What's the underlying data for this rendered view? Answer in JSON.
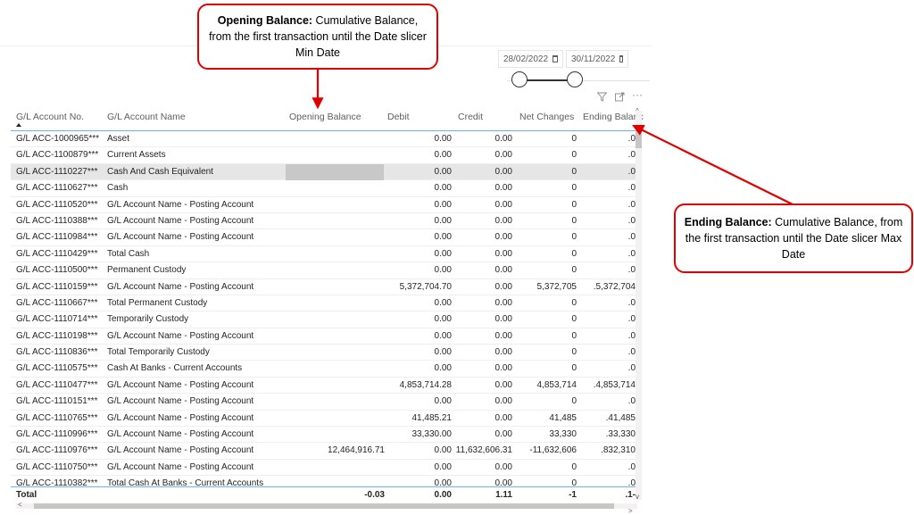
{
  "annotations": {
    "opening": {
      "title": "Opening Balance:",
      "text": " Cumulative Balance, from the first transaction until the Date slicer Min Date"
    },
    "ending": {
      "title": "Ending Balance:",
      "text": " Cumulative Balance, from the first transaction until the Date slicer Max Date"
    },
    "color": "#e00000"
  },
  "date_slicer": {
    "start_date": "28/02/2022",
    "end_date": "30/11/2022",
    "calendar_icon": "calendar-icon"
  },
  "visual_header": {
    "icons": [
      "filter-icon",
      "focus-mode-icon",
      "more-options-icon"
    ],
    "more_glyph": "···"
  },
  "table": {
    "columns": [
      "G/L Account No.",
      "G/L Account Name",
      "Opening Balance",
      "Debit",
      "Credit",
      "Net Changes",
      "Ending Balanc"
    ],
    "sorted_column": "G/L Account No.",
    "accent_color": "#6cb2eb",
    "rows": [
      {
        "no": "G/L ACC-1000965***",
        "name": "Asset",
        "opening": "",
        "debit": "0.00",
        "credit": "0.00",
        "net": "0",
        "ending": "0."
      },
      {
        "no": "G/L ACC-1100879***",
        "name": "Current Assets",
        "opening": "",
        "debit": "0.00",
        "credit": "0.00",
        "net": "0",
        "ending": "0."
      },
      {
        "no": "G/L ACC-1110227***",
        "name": "Cash And Cash Equivalent",
        "opening": "",
        "debit": "0.00",
        "credit": "0.00",
        "net": "0",
        "ending": "0.",
        "highlighted": true
      },
      {
        "no": "G/L ACC-1110627***",
        "name": "Cash",
        "opening": "",
        "debit": "0.00",
        "credit": "0.00",
        "net": "0",
        "ending": "0."
      },
      {
        "no": "G/L ACC-1110520***",
        "name": "G/L Account Name - Posting Account",
        "opening": "",
        "debit": "0.00",
        "credit": "0.00",
        "net": "0",
        "ending": "0."
      },
      {
        "no": "G/L ACC-1110388***",
        "name": "G/L Account Name - Posting Account",
        "opening": "",
        "debit": "0.00",
        "credit": "0.00",
        "net": "0",
        "ending": "0."
      },
      {
        "no": "G/L ACC-1110984***",
        "name": "G/L Account Name - Posting Account",
        "opening": "",
        "debit": "0.00",
        "credit": "0.00",
        "net": "0",
        "ending": "0."
      },
      {
        "no": "G/L ACC-1110429***",
        "name": "Total Cash",
        "opening": "",
        "debit": "0.00",
        "credit": "0.00",
        "net": "0",
        "ending": "0."
      },
      {
        "no": "G/L ACC-1110500***",
        "name": "Permanent Custody",
        "opening": "",
        "debit": "0.00",
        "credit": "0.00",
        "net": "0",
        "ending": "0."
      },
      {
        "no": "G/L ACC-1110159***",
        "name": "G/L Account Name - Posting Account",
        "opening": "",
        "debit": "5,372,704.70",
        "credit": "0.00",
        "net": "5,372,705",
        "ending": "5,372,704."
      },
      {
        "no": "G/L ACC-1110667***",
        "name": "Total Permanent Custody",
        "opening": "",
        "debit": "0.00",
        "credit": "0.00",
        "net": "0",
        "ending": "0."
      },
      {
        "no": "G/L ACC-1110714***",
        "name": "Temporarily Custody",
        "opening": "",
        "debit": "0.00",
        "credit": "0.00",
        "net": "0",
        "ending": "0."
      },
      {
        "no": "G/L ACC-1110198***",
        "name": "G/L Account Name - Posting Account",
        "opening": "",
        "debit": "0.00",
        "credit": "0.00",
        "net": "0",
        "ending": "0."
      },
      {
        "no": "G/L ACC-1110836***",
        "name": "Total Temporarily Custody",
        "opening": "",
        "debit": "0.00",
        "credit": "0.00",
        "net": "0",
        "ending": "0."
      },
      {
        "no": "G/L ACC-1110575***",
        "name": "Cash At Banks - Current Accounts",
        "opening": "",
        "debit": "0.00",
        "credit": "0.00",
        "net": "0",
        "ending": "0."
      },
      {
        "no": "G/L ACC-1110477***",
        "name": "G/L Account Name - Posting Account",
        "opening": "",
        "debit": "4,853,714.28",
        "credit": "0.00",
        "net": "4,853,714",
        "ending": "4,853,714."
      },
      {
        "no": "G/L ACC-1110151***",
        "name": "G/L Account Name - Posting Account",
        "opening": "",
        "debit": "0.00",
        "credit": "0.00",
        "net": "0",
        "ending": "0."
      },
      {
        "no": "G/L ACC-1110765***",
        "name": "G/L Account Name - Posting Account",
        "opening": "",
        "debit": "41,485.21",
        "credit": "0.00",
        "net": "41,485",
        "ending": "41,485."
      },
      {
        "no": "G/L ACC-1110996***",
        "name": "G/L Account Name - Posting Account",
        "opening": "",
        "debit": "33,330.00",
        "credit": "0.00",
        "net": "33,330",
        "ending": "33,330."
      },
      {
        "no": "G/L ACC-1110976***",
        "name": "G/L Account Name - Posting Account",
        "opening": "12,464,916.71",
        "debit": "0.00",
        "credit": "11,632,606.31",
        "net": "-11,632,606",
        "ending": "832,310."
      },
      {
        "no": "G/L ACC-1110750***",
        "name": "G/L Account Name - Posting Account",
        "opening": "",
        "debit": "0.00",
        "credit": "0.00",
        "net": "0",
        "ending": "0."
      },
      {
        "no": "G/L ACC-1110382***",
        "name": "Total Cash At Banks - Current Accounts",
        "opening": "",
        "debit": "0.00",
        "credit": "0.00",
        "net": "0",
        "ending": "0."
      }
    ],
    "total": {
      "label": "Total",
      "opening": "-0.03",
      "debit": "0.00",
      "credit": "1.11",
      "net": "-1",
      "ending": "-1."
    },
    "scroll": {
      "up": "^",
      "down": "v",
      "left": "<",
      "right": ">"
    }
  }
}
